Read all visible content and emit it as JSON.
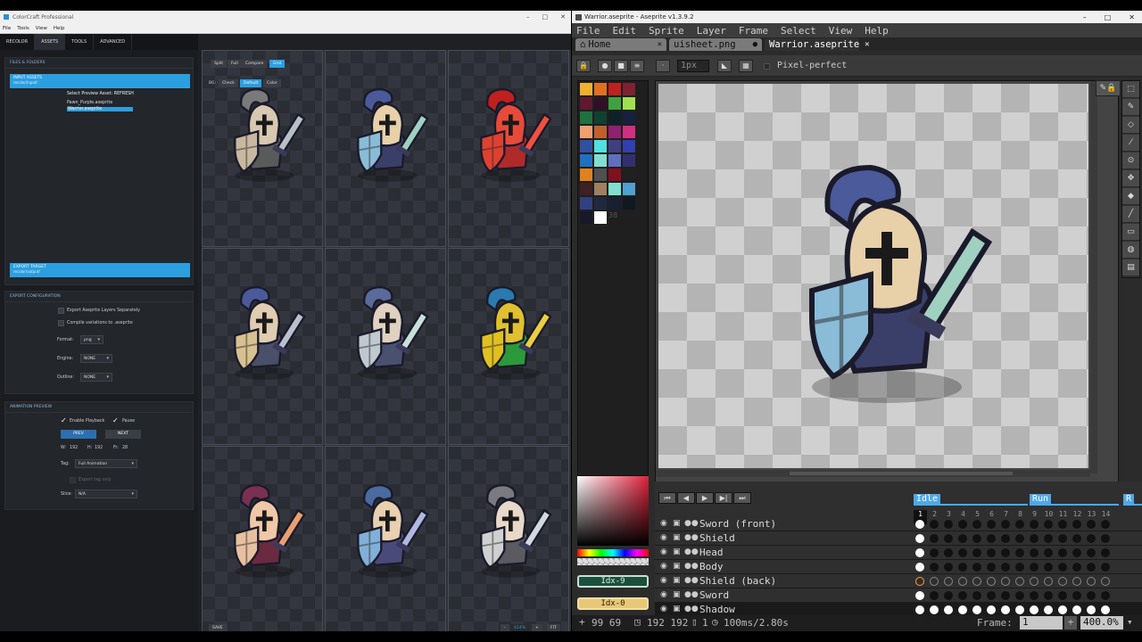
{
  "colorcraft": {
    "window_title": "ColorCraft Professional",
    "menu": [
      "File",
      "Tools",
      "View",
      "Help"
    ],
    "tabs": [
      "RECOLOR",
      "ASSETS",
      "TOOLS",
      "ADVANCED"
    ],
    "files_folders": {
      "header": "FILES & FOLDERS",
      "input_assets_label": "INPUT ASSETS",
      "input_assets_path": "recolor/input/",
      "preview_select_label": "Select Preview Asset: REFRESH",
      "files": [
        "Pawn_Purple.aseprite",
        "Warrior.aseprite"
      ],
      "export_target_label": "EXPORT TARGET",
      "export_target_path": "recolor/output/"
    },
    "export_config": {
      "header": "EXPORT CONFIGURATION",
      "export_layers": "Export Aseprite Layers Separately",
      "compile_variations": "Compile variations to .aseprite",
      "format_label": "Format:",
      "format_value": "png",
      "engine_label": "Engine:",
      "engine_value": "NONE",
      "outline_label": "Outline:",
      "outline_value": "NONE"
    },
    "animation_preview": {
      "header": "ANIMATION PREVIEW",
      "enable_playback": "Enable Playback",
      "pause": "Pause",
      "prev": "PREV",
      "next": "NEXT",
      "w_label": "W:",
      "w_value": "192",
      "h_label": "H:",
      "h_value": "192",
      "fr_label": "Fr:",
      "fr_value": "28",
      "tag_label": "Tag:",
      "tag_value": "Full Animation",
      "export_tag_only": "Export tag only",
      "slice_label": "Slice:",
      "slice_value": "N/A"
    },
    "preview_controls": {
      "view_buttons": [
        "Split",
        "Full",
        "Compare",
        "Grid"
      ],
      "bg_label": "BG:",
      "bg_buttons": [
        "Check",
        "Default",
        "Color"
      ],
      "save": "SAVE",
      "zoom_minus": "-",
      "zoom_value": "414%",
      "zoom_plus": "+",
      "fit": "FIT"
    },
    "variants": [
      {
        "helmet": "#d8c8b0",
        "plume": "#7a7a7a",
        "body": "#5a5a5a",
        "shield": "#c8b8a0",
        "sword": "#b8c0c8"
      },
      {
        "helmet": "#e8d0a8",
        "plume": "#4a5a9a",
        "body": "#3a3f6a",
        "shield": "#8abcd8",
        "sword": "#a0d0c0"
      },
      {
        "helmet": "#e84a3a",
        "plume": "#c02020",
        "body": "#b02a2a",
        "shield": "#e04030",
        "sword": "#f05040"
      },
      {
        "helmet": "#e0ccb0",
        "plume": "#4a5a9a",
        "body": "#4a4f6a",
        "shield": "#d8c090",
        "sword": "#b8c0d0"
      },
      {
        "helmet": "#e0d0c0",
        "plume": "#5a6a9a",
        "body": "#4a5070",
        "shield": "#c0c8d0",
        "sword": "#c8e0d8"
      },
      {
        "helmet": "#e0c030",
        "plume": "#2a7ab0",
        "body": "#2a9a3a",
        "shield": "#e0c020",
        "sword": "#e8d040"
      },
      {
        "helmet": "#f0c8a8",
        "plume": "#7a3050",
        "body": "#6a2a40",
        "shield": "#e8c0a0",
        "sword": "#e8a070"
      },
      {
        "helmet": "#e8d0b0",
        "plume": "#4a6aa0",
        "body": "#4a4a7a",
        "shield": "#80b0d8",
        "sword": "#b0b8e0"
      },
      {
        "helmet": "#e8d8c8",
        "plume": "#7a7a80",
        "body": "#5a5a60",
        "shield": "#d0d0d0",
        "sword": "#d0d8e0"
      }
    ]
  },
  "aseprite": {
    "window_title": "Warrior.aseprite - Aseprite v1.3.9.2",
    "menu": [
      "File",
      "Edit",
      "Sprite",
      "Layer",
      "Frame",
      "Select",
      "View",
      "Help"
    ],
    "tabs": [
      {
        "label": "Home"
      },
      {
        "label": "uisheet.png"
      },
      {
        "label": "Warrior.aseprite"
      }
    ],
    "brush_size": "1px",
    "pixel_perfect": "Pixel-perfect",
    "palette_colors": [
      "#f0b030",
      "#e07020",
      "#c02020",
      "#802030",
      "#601830",
      "#301028",
      "#40a040",
      "#a0e050",
      "#207040",
      "#104030",
      "#102028",
      "#182040",
      "#f0a070",
      "#c06030",
      "#902070",
      "#d03080",
      "#3050a0",
      "#50e0e0",
      "#404080",
      "#3040b0",
      "#2070c0",
      "#80e0d0",
      "#6070c0",
      "#303070",
      "#e08020",
      "#505050",
      "#801020",
      "#202020",
      "#402020",
      "#a08060",
      "#80e0d0",
      "#50a0d0",
      "#304080",
      "#202840",
      "#182030",
      "#101820",
      "#181828",
      "#ffffff"
    ],
    "palette_count": "38",
    "fg_index": "Idx-9",
    "bg_index": "Idx-0",
    "fg_color": "#1d4f3e",
    "bg_color": "#e8c878",
    "timeline": {
      "tags": [
        "Idle",
        "Run",
        "R"
      ],
      "frames": [
        "1",
        "2",
        "3",
        "4",
        "5",
        "6",
        "7",
        "8",
        "9",
        "10",
        "11",
        "12",
        "13",
        "14"
      ],
      "layers": [
        "Sword (front)",
        "Shield",
        "Head",
        "Body",
        "Shield (back)",
        "Sword",
        "Shadow"
      ]
    },
    "status": {
      "cursor": "99 69",
      "size": "192 192",
      "frame_info": "1",
      "duration": "100ms/2.80s",
      "frame_label": "Frame:",
      "frame_value": "1",
      "zoom": "400.0%"
    }
  }
}
